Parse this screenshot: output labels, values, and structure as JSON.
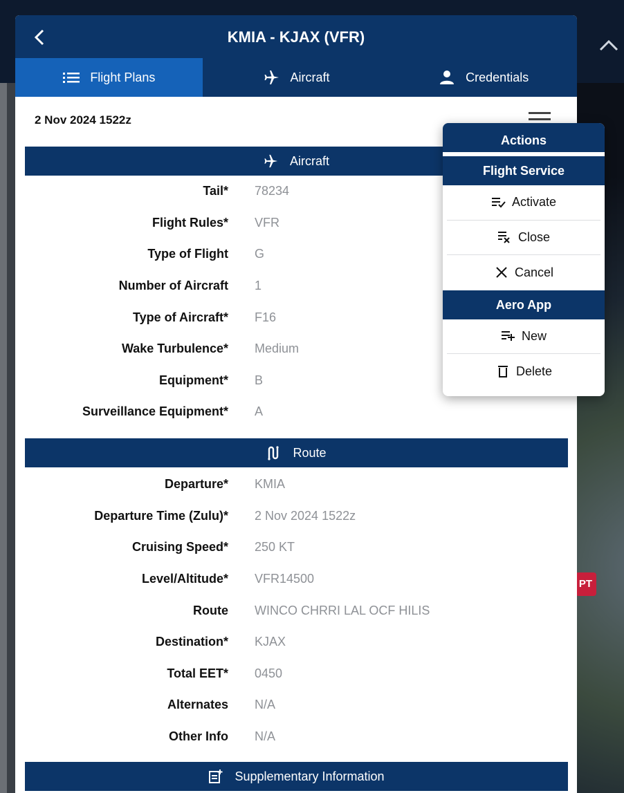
{
  "window": {
    "title": "KMIA - KJAX (VFR)"
  },
  "tabs": [
    {
      "label": "Flight Plans",
      "icon": "list-icon",
      "active": true
    },
    {
      "label": "Aircraft",
      "icon": "airplane-icon",
      "active": false
    },
    {
      "label": "Credentials",
      "icon": "person-icon",
      "active": false
    }
  ],
  "date_header": "2 Nov 2024 1522z",
  "aircraft_section": {
    "title": "Aircraft",
    "rows": [
      {
        "label": "Tail*",
        "value": "78234"
      },
      {
        "label": "Flight Rules*",
        "value": "VFR"
      },
      {
        "label": "Type of Flight",
        "value": "G"
      },
      {
        "label": "Number of Aircraft",
        "value": "1"
      },
      {
        "label": "Type of Aircraft*",
        "value": "F16"
      },
      {
        "label": "Wake Turbulence*",
        "value": "Medium"
      },
      {
        "label": "Equipment*",
        "value": "B"
      },
      {
        "label": "Surveillance Equipment*",
        "value": "A"
      }
    ]
  },
  "route_section": {
    "title": "Route",
    "rows": [
      {
        "label": "Departure*",
        "value": "KMIA"
      },
      {
        "label": "Departure Time (Zulu)*",
        "value": "2 Nov 2024 1522z"
      },
      {
        "label": "Cruising Speed*",
        "value": "250 KT"
      },
      {
        "label": "Level/Altitude*",
        "value": "VFR14500"
      },
      {
        "label": "Route",
        "value": "WINCO CHRRI LAL OCF HILIS"
      },
      {
        "label": "Destination*",
        "value": "KJAX"
      },
      {
        "label": "Total EET*",
        "value": "0450"
      },
      {
        "label": "Alternates",
        "value": "N/A"
      },
      {
        "label": "Other Info",
        "value": "N/A"
      }
    ]
  },
  "supplementary_section": {
    "title": "Supplementary Information"
  },
  "actions_menu": {
    "title": "Actions",
    "flight_service": {
      "title": "Flight Service",
      "items": [
        {
          "label": "Activate",
          "icon": "list-check-icon"
        },
        {
          "label": "Close",
          "icon": "list-x-icon"
        },
        {
          "label": "Cancel",
          "icon": "x-icon"
        }
      ]
    },
    "aero_app": {
      "title": "Aero App",
      "items": [
        {
          "label": "New",
          "icon": "list-plus-icon"
        },
        {
          "label": "Delete",
          "icon": "trash-icon"
        }
      ]
    }
  },
  "background": {
    "map_badge": "PT"
  },
  "colors": {
    "navy": "#0c3568",
    "tab_active": "#1562b8",
    "value_gray": "#8e9196"
  }
}
